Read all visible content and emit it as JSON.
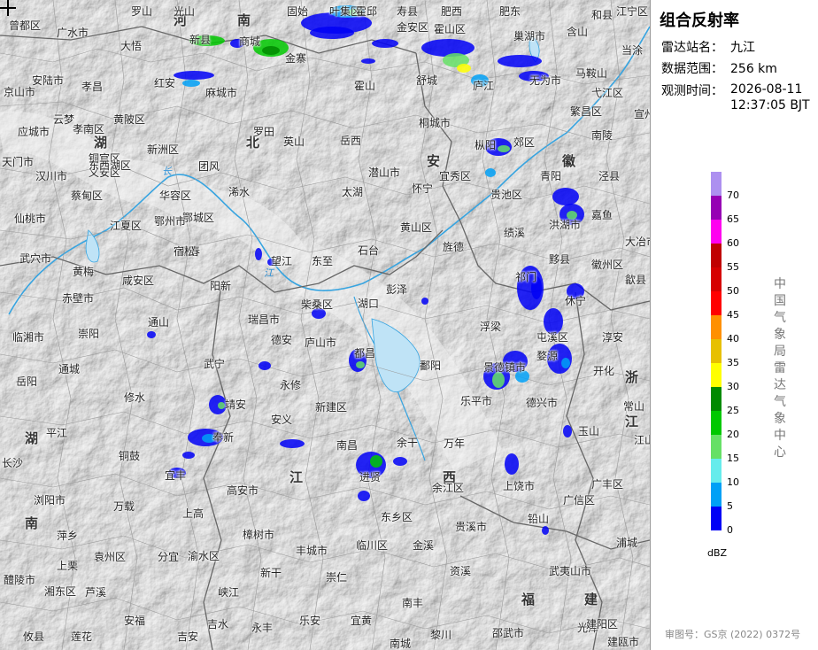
{
  "panel": {
    "title": "组合反射率",
    "station_label": "雷达站名：",
    "station_value": "九江",
    "range_label": "数据范围：",
    "range_value": "256 km",
    "time_label": "观测时间：",
    "time_date": "2026-08-11",
    "time_clock": "12:37:05 BJT",
    "unit": "dBZ",
    "agency": "中国气象局雷达气象中心",
    "approval": "审图号：GS京 (2022) 0372号"
  },
  "legend": [
    {
      "label": "70",
      "color": "#ad90f0"
    },
    {
      "label": "65",
      "color": "#9600b4"
    },
    {
      "label": "60",
      "color": "#ff00f0"
    },
    {
      "label": "55",
      "color": "#c00000"
    },
    {
      "label": "50",
      "color": "#d60000"
    },
    {
      "label": "45",
      "color": "#ff0000"
    },
    {
      "label": "40",
      "color": "#ff9000"
    },
    {
      "label": "35",
      "color": "#e7c000"
    },
    {
      "label": "30",
      "color": "#ffff00"
    },
    {
      "label": "25",
      "color": "#008a00"
    },
    {
      "label": "20",
      "color": "#00c800"
    },
    {
      "label": "15",
      "color": "#66e066"
    },
    {
      "label": "10",
      "color": "#66ecec"
    },
    {
      "label": "5",
      "color": "#00a0f6"
    },
    {
      "label": "0",
      "color": "#0000f6"
    }
  ],
  "provinces": [
    "河",
    "南",
    "湖",
    "北",
    "安",
    "徽",
    "湖",
    "南",
    "江",
    "西",
    "浙",
    "江",
    "福",
    "建"
  ],
  "rivers": [
    "长",
    "江"
  ],
  "cities": [
    "曾都区",
    "罗山",
    "光山",
    "固始",
    "叶集区",
    "霍邱",
    "寿县",
    "金安区",
    "霍山区",
    "肥西",
    "肥东",
    "和县",
    "江宁区",
    "当涂",
    "广水市",
    "大悟",
    "新县",
    "商城",
    "金寨",
    "舒城",
    "巢湖市",
    "含山",
    "马鞍山",
    "安陆市",
    "孝昌",
    "红安",
    "麻城市",
    "霍山",
    "庐江",
    "无为市",
    "弋江区",
    "京山市",
    "云梦",
    "孝南区",
    "黄陂区",
    "罗田",
    "英山",
    "岳西",
    "桐城市",
    "枞阳",
    "郊区",
    "繁昌区",
    "南陵",
    "宣州区",
    "应城市",
    "新洲区",
    "团风",
    "浠水",
    "潜山市",
    "铜官区",
    "义安区",
    "天门市",
    "汉川市",
    "东西湖区",
    "宜秀区",
    "青阳",
    "泾县",
    "蔡甸区",
    "华容区",
    "鄂城区",
    "太湖",
    "怀宁",
    "贵池区",
    "仙桃市",
    "江夏区",
    "鄂州市",
    "蕲春",
    "望江",
    "东至",
    "石台",
    "黄山区",
    "旌德",
    "绩溪",
    "洪湖市",
    "嘉鱼",
    "大冶市",
    "武穴市",
    "黄梅",
    "宿松",
    "黟县",
    "徽州区",
    "歙县",
    "咸安区",
    "阳新",
    "湖口",
    "彭泽",
    "祁门",
    "休宁",
    "赤壁市",
    "瑞昌市",
    "柴桑区",
    "浮梁",
    "屯溪区",
    "临湘市",
    "崇阳",
    "通山",
    "德安",
    "庐山市",
    "都昌",
    "鄱阳",
    "婺源",
    "淳安",
    "岳阳",
    "通城",
    "武宁",
    "永修",
    "景德镇市",
    "开化",
    "修水",
    "靖安",
    "安义",
    "新建区",
    "乐平市",
    "德兴市",
    "常山",
    "平江",
    "奉新",
    "南昌",
    "余干",
    "万年",
    "玉山",
    "江山市",
    "铜鼓",
    "宜丰",
    "进贤",
    "余江区",
    "上饶市",
    "长沙",
    "高安市",
    "东乡区",
    "广信区",
    "广丰区",
    "浏阳市",
    "万载",
    "上高",
    "樟树市",
    "丰城市",
    "贵溪市",
    "铅山",
    "浦城",
    "萍乡",
    "袁州区",
    "分宜",
    "渝水区",
    "临川区",
    "金溪",
    "资溪",
    "武夷山市",
    "醴陵市",
    "上栗",
    "新干",
    "崇仁",
    "光泽",
    "湘东区",
    "芦溪",
    "峡江",
    "南丰",
    "建阳区",
    "攸县",
    "莲花",
    "安福",
    "吉安",
    "吉水",
    "永丰",
    "乐安",
    "宜黄",
    "南城",
    "黎川",
    "邵武市",
    "建瓯市"
  ]
}
